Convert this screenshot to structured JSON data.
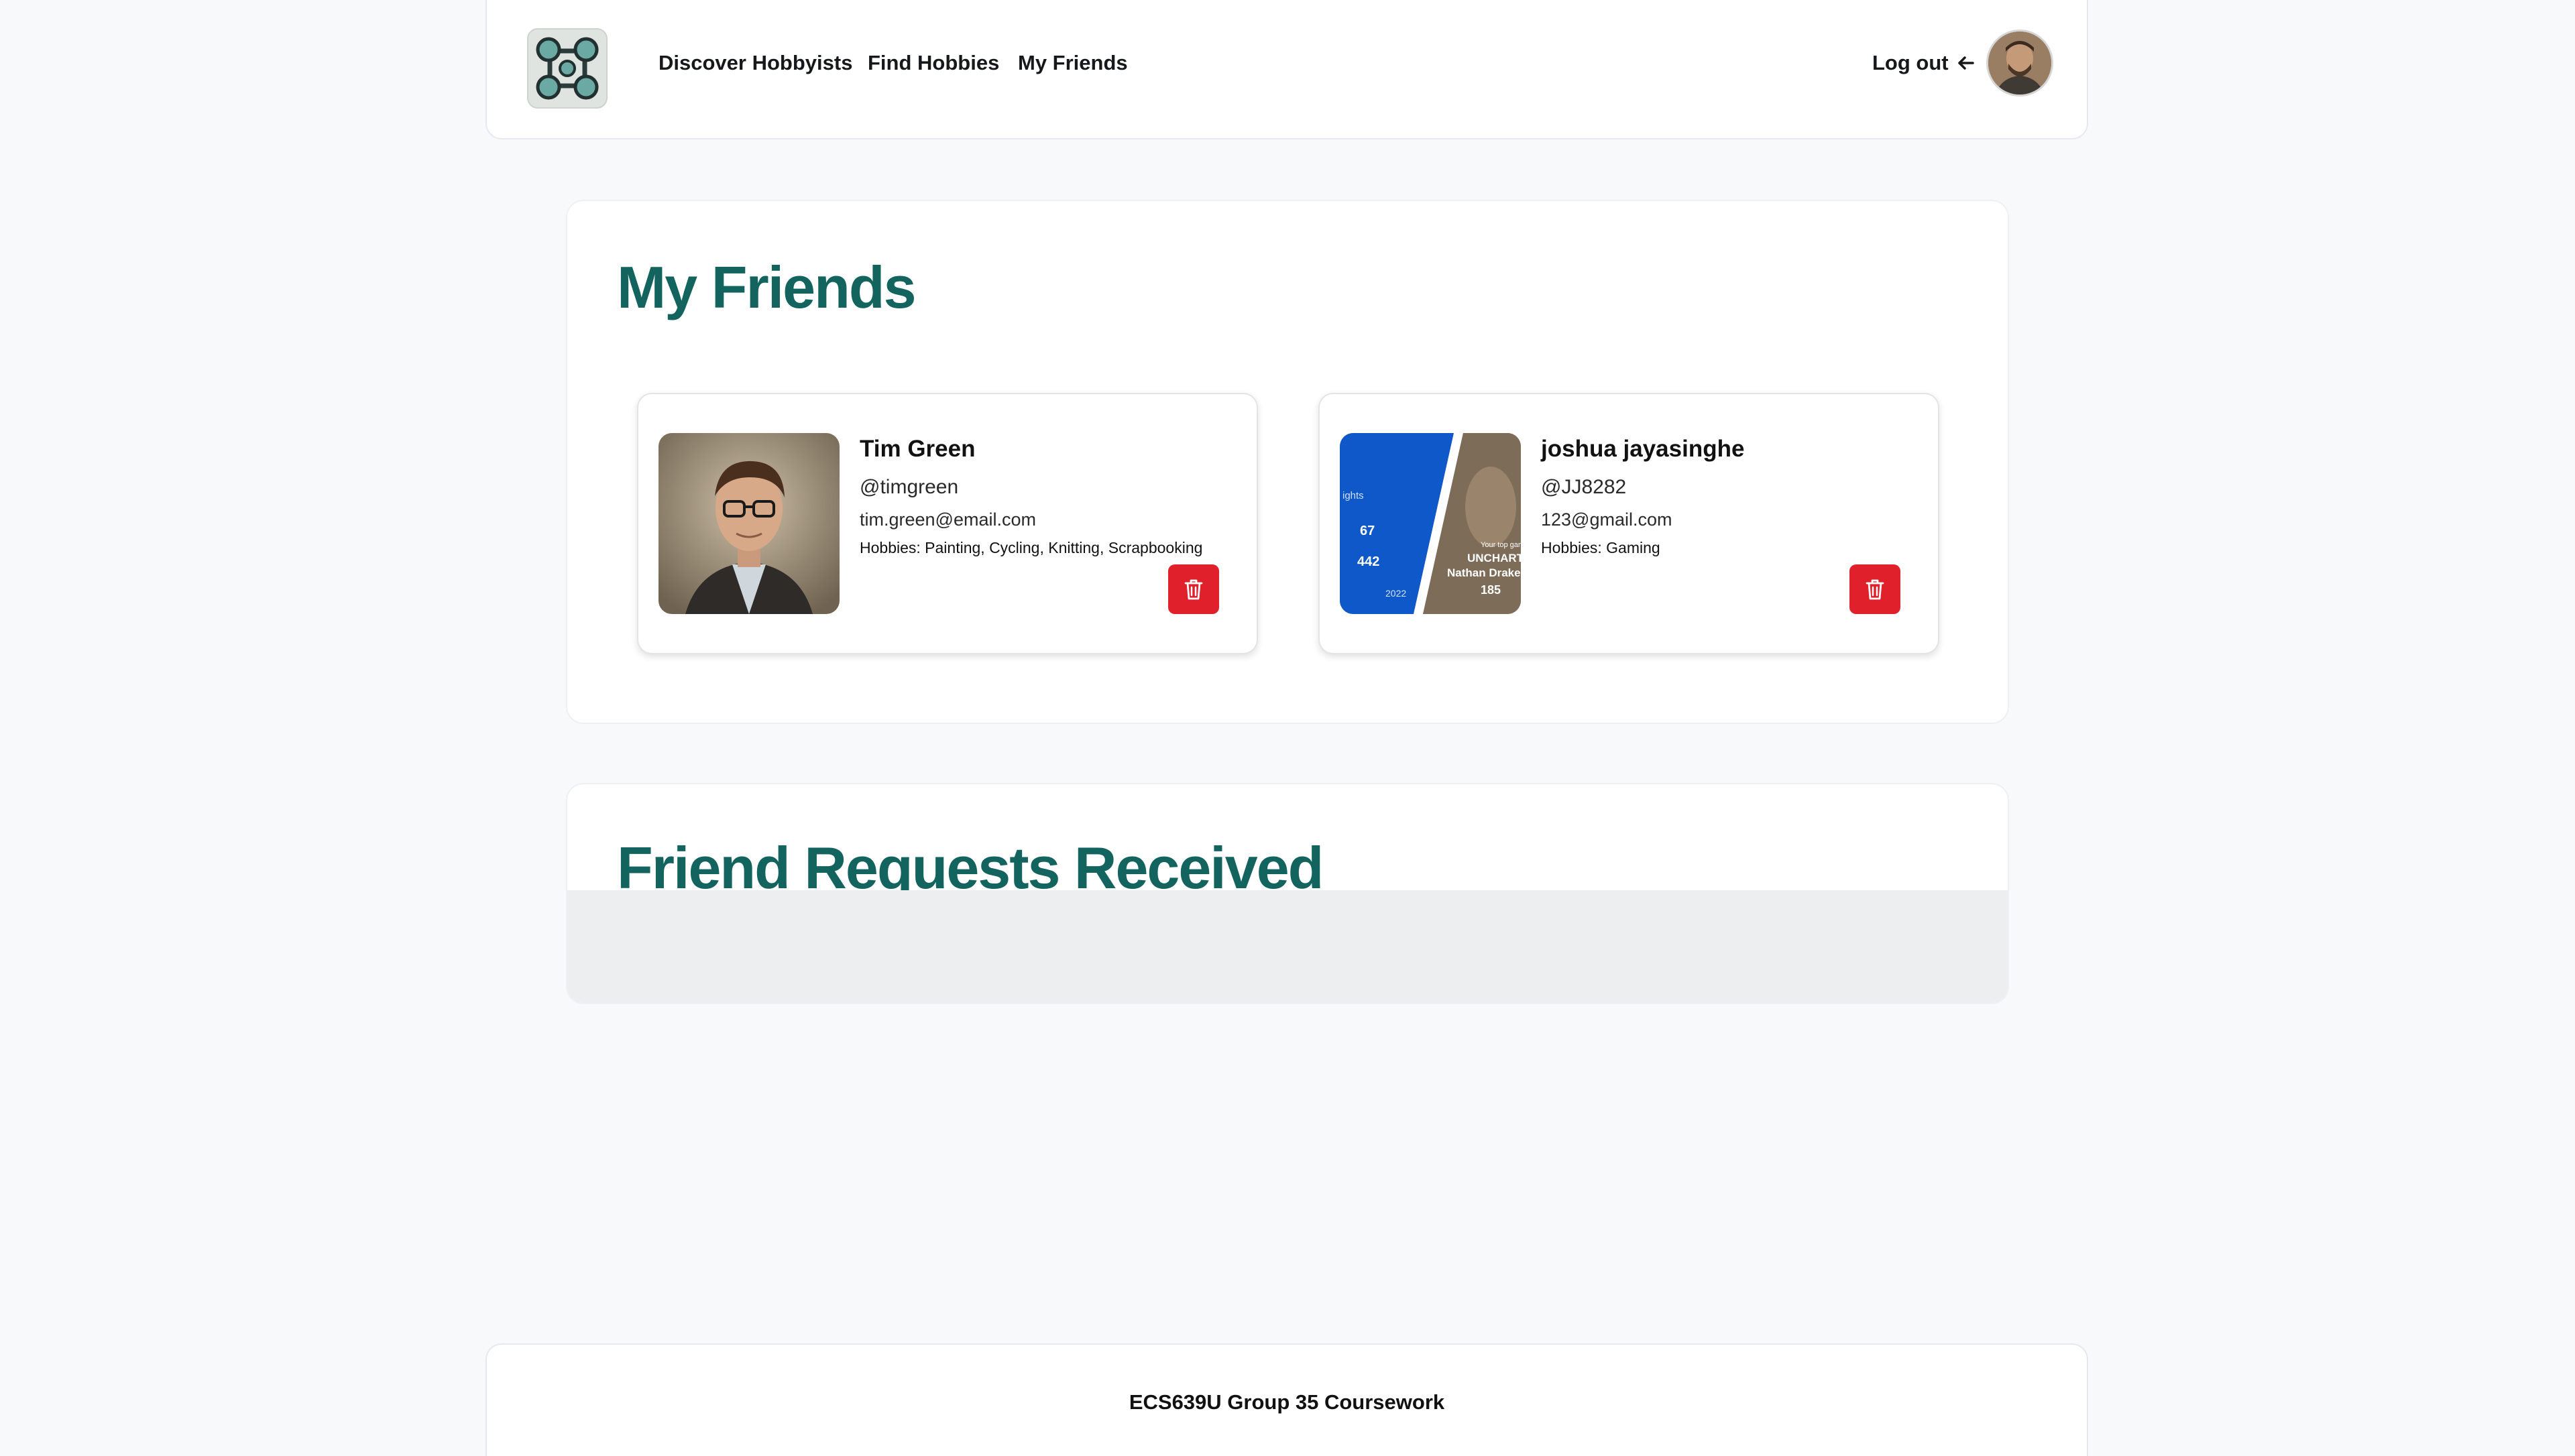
{
  "nav": {
    "links": [
      "Discover Hobbyists",
      "Find Hobbies",
      "My Friends"
    ],
    "logout_label": "Log out"
  },
  "friends_section": {
    "title": "My Friends",
    "friends": [
      {
        "name": "Tim Green",
        "handle": "@timgreen",
        "email": "tim.green@email.com",
        "hobbies": "Hobbies: Painting, Cycling, Knitting, Scrapbooking"
      },
      {
        "name": "joshua jayasinghe",
        "handle": "@JJ8282",
        "email": "123@gmail.com",
        "hobbies": "Hobbies: Gaming",
        "photo_text": {
          "stat1": "67",
          "stat2": "442",
          "year": "2022",
          "caption": "Your top game",
          "game": "UNCHARTED",
          "character": "Nathan Drake",
          "hours": "185",
          "frag": "ights"
        }
      }
    ]
  },
  "requests_section": {
    "title": "Friend Requests Received"
  },
  "footer": {
    "text": "ECS639U Group 35 Coursework"
  },
  "colors": {
    "accent_teal": "#13645e",
    "danger_red": "#e0202a",
    "page_bg": "#f8f9fb"
  },
  "icons": [
    "network-logo-icon",
    "arrow-left-icon",
    "trash-icon"
  ]
}
